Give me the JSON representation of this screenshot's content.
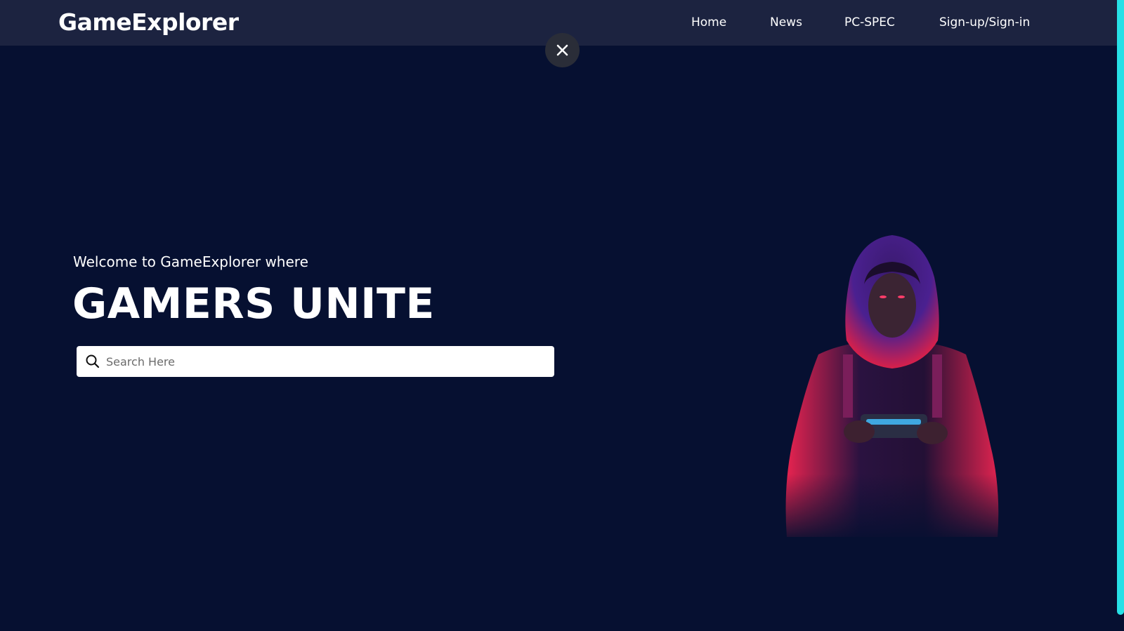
{
  "navbar": {
    "brand": "GameExplorer",
    "links": [
      {
        "label": "Home"
      },
      {
        "label": "News"
      },
      {
        "label": "PC-SPEC"
      },
      {
        "label": "Sign-up/Sign-in"
      }
    ]
  },
  "hero": {
    "welcome": "Welcome to GameExplorer where",
    "title": "GAMERS UNITE",
    "search": {
      "placeholder": "Search Here",
      "value": ""
    }
  },
  "icons": {
    "close": "close-icon",
    "search": "search-icon"
  },
  "colors": {
    "background": "#061031",
    "navbar": "#1c2340",
    "scrollbar": "#27e0e6",
    "hood_accent": "#e8234f",
    "hood_purple": "#5a2fa0"
  }
}
